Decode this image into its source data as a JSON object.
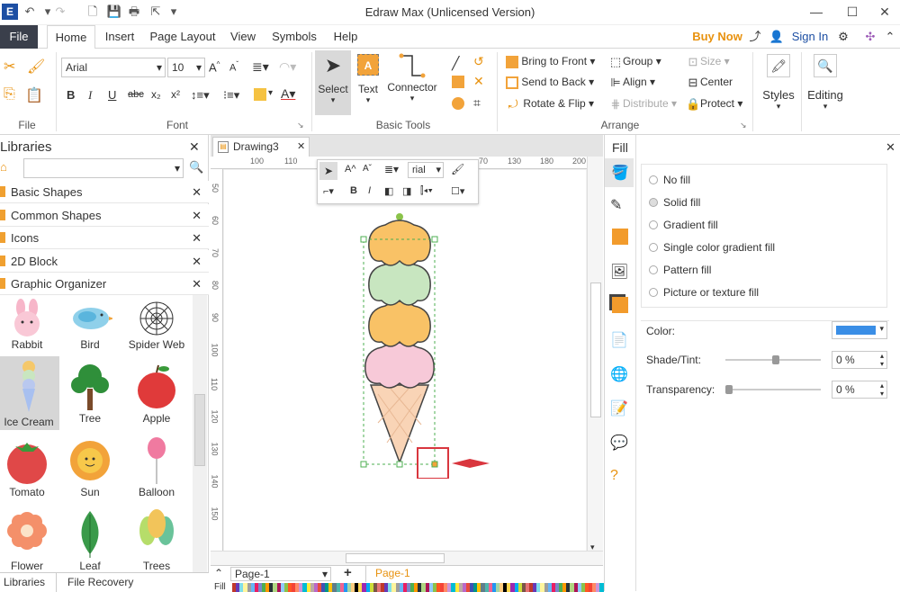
{
  "app": {
    "title": "Edraw Max (Unlicensed Version)"
  },
  "menu": {
    "file": "File",
    "tabs": [
      "Home",
      "Insert",
      "Page Layout",
      "View",
      "Symbols",
      "Help"
    ],
    "buy_now": "Buy Now",
    "sign_in": "Sign In"
  },
  "ribbon": {
    "font_name": "Arial",
    "font_size": "10",
    "file_group": "File",
    "font_group": "Font",
    "basic_tools_group": "Basic Tools",
    "arrange_group": "Arrange",
    "select": "Select",
    "text": "Text",
    "connector": "Connector",
    "bring_to_front": "Bring to Front",
    "send_to_back": "Send to Back",
    "rotate_flip": "Rotate & Flip",
    "group": "Group",
    "align": "Align",
    "distribute": "Distribute",
    "size": "Size",
    "center": "Center",
    "protect": "Protect",
    "styles": "Styles",
    "editing": "Editing"
  },
  "libraries": {
    "title": "Libraries",
    "categories": [
      "Basic Shapes",
      "Common Shapes",
      "Icons",
      "2D Block",
      "Graphic Organizer"
    ],
    "shapes": [
      "Rabbit",
      "Bird",
      "Spider Web",
      "Ice Cream",
      "Tree",
      "Apple",
      "Tomato",
      "Sun",
      "Balloon",
      "Flower",
      "Leaf",
      "Trees"
    ],
    "bottom_tabs": [
      "Libraries",
      "File Recovery"
    ]
  },
  "canvas": {
    "tab": "Drawing3",
    "ruler_top": [
      "100",
      "110",
      "70",
      "130",
      "180",
      "200"
    ],
    "ruler_left": [
      "50",
      "60",
      "70",
      "80",
      "90",
      "100",
      "110",
      "120",
      "130",
      "140",
      "150"
    ],
    "mini_font": "rial",
    "page_tab": "Page-1",
    "page_tab_active": "Page-1",
    "fill_label": "Fill"
  },
  "fill": {
    "title": "Fill",
    "options": [
      "No fill",
      "Solid fill",
      "Gradient fill",
      "Single color gradient fill",
      "Pattern fill",
      "Picture or texture fill"
    ],
    "selected": "Solid fill",
    "color_label": "Color:",
    "shade_label": "Shade/Tint:",
    "shade_value": "0 %",
    "transparency_label": "Transparency:",
    "transparency_value": "0 %",
    "color": "#3a8ee6"
  }
}
